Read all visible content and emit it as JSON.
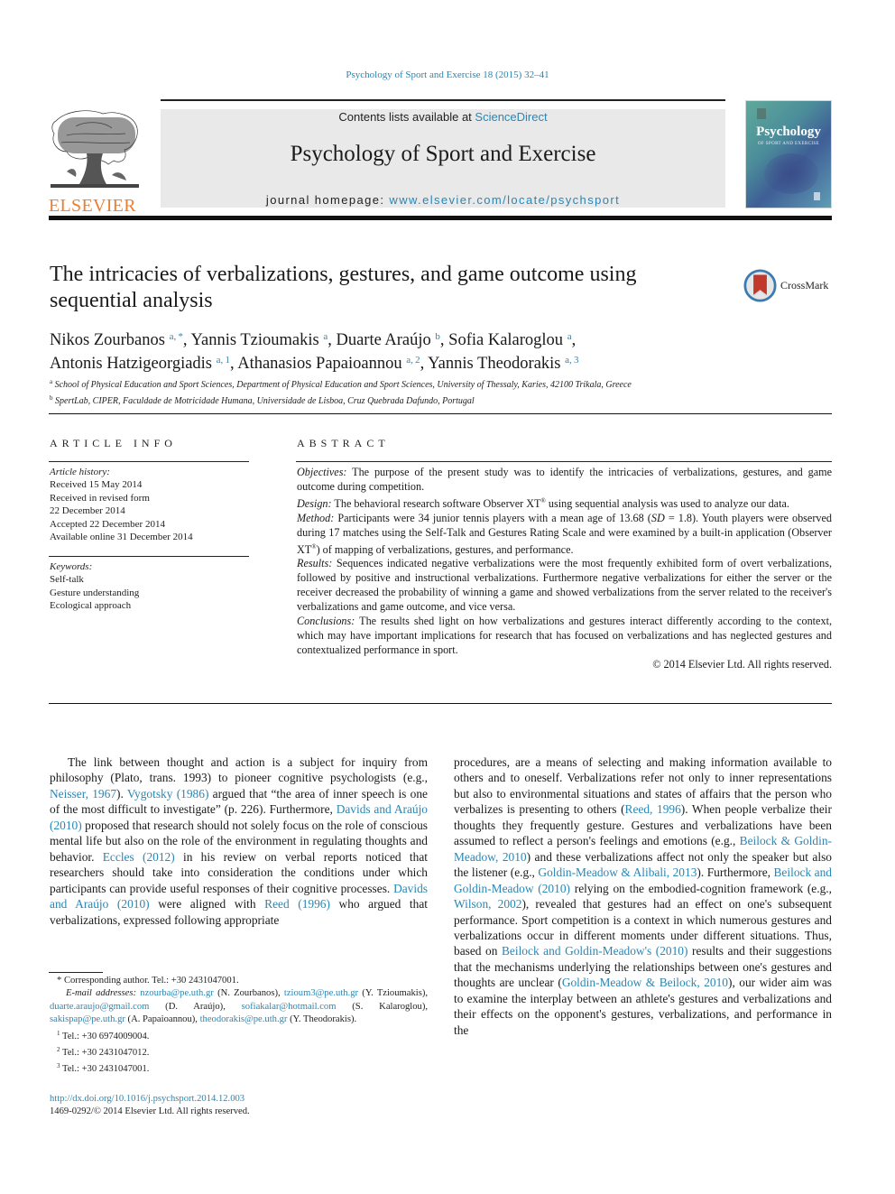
{
  "citation": "Psychology of Sport and Exercise 18 (2015) 32–41",
  "header": {
    "publisher_logo_text": "ELSEVIER",
    "contents_prefix": "Contents lists available at ",
    "contents_link": "ScienceDirect",
    "journal_title": "Psychology of Sport and Exercise",
    "homepage_prefix": "journal homepage: ",
    "homepage_link": "www.elsevier.com/locate/psychsport",
    "cover_title": "Psychology",
    "cover_subtitle": "OF SPORT AND EXERCISE"
  },
  "article": {
    "title": "The intricacies of verbalizations, gestures, and game outcome using sequential analysis",
    "crossmark_label": "CrossMark",
    "authors": [
      {
        "name": "Nikos Zourbanos",
        "sup": "a, *",
        "sep": ", "
      },
      {
        "name": "Yannis Tzioumakis",
        "sup": "a",
        "sep": ", "
      },
      {
        "name": "Duarte Araújo",
        "sup": "b",
        "sep": ", "
      },
      {
        "name": "Sofia Kalaroglou",
        "sup": "a",
        "sep": ","
      },
      {
        "name": "Antonis Hatzigeorgiadis",
        "sup": "a, 1",
        "sep": ", "
      },
      {
        "name": "Athanasios Papaioannou",
        "sup": "a, 2",
        "sep": ", "
      },
      {
        "name": "Yannis Theodorakis",
        "sup": "a, 3",
        "sep": ""
      }
    ],
    "affiliations": [
      {
        "mark": "a",
        "text": "School of Physical Education and Sport Sciences, Department of Physical Education and Sport Sciences, University of Thessaly, Karies, 42100 Trikala, Greece"
      },
      {
        "mark": "b",
        "text": "SpertLab, CIPER, Faculdade de Motricidade Humana, Universidade de Lisboa, Cruz Quebrada Dafundo, Portugal"
      }
    ]
  },
  "article_info": {
    "heading": "ARTICLE INFO",
    "history_label": "Article history:",
    "history": [
      "Received 15 May 2014",
      "Received in revised form",
      "22 December 2014",
      "Accepted 22 December 2014",
      "Available online 31 December 2014"
    ],
    "keywords_label": "Keywords:",
    "keywords": [
      "Self-talk",
      "Gesture understanding",
      "Ecological approach"
    ]
  },
  "abstract": {
    "heading": "ABSTRACT",
    "sections": [
      {
        "label": "Objectives:",
        "text": " The purpose of the present study was to identify the intricacies of verbalizations, gestures, and game outcome during competition."
      },
      {
        "label": "Design:",
        "text_before": " The behavioral research software Observer XT",
        "reg": "®",
        "text_after": " using sequential analysis was used to analyze our data."
      },
      {
        "label": "Method:",
        "text_before": " Participants were 34 junior tennis players with a mean age of 13.68 (",
        "sd": "SD",
        "text_mid": " = 1.8). Youth players were observed during 17 matches using the Self-Talk and Gestures Rating Scale and were examined by a built-in application (Observer XT",
        "reg": "®",
        "text_after": ") of mapping of verbalizations, gestures, and performance."
      },
      {
        "label": "Results:",
        "text": " Sequences indicated negative verbalizations were the most frequently exhibited form of overt verbalizations, followed by positive and instructional verbalizations. Furthermore negative verbalizations for either the server or the receiver decreased the probability of winning a game and showed verbalizations from the server related to the receiver's verbalizations and game outcome, and vice versa."
      },
      {
        "label": "Conclusions:",
        "text": " The results shed light on how verbalizations and gestures interact differently according to the context, which may have important implications for research that has focused on verbalizations and has neglected gestures and contextualized performance in sport."
      }
    ],
    "copyright": "© 2014 Elsevier Ltd. All rights reserved."
  },
  "body": {
    "left": [
      {
        "t": "The link between thought and action is a subject for inquiry from philosophy (Plato, trans. 1993) to pioneer cognitive psychologists (e.g., "
      },
      {
        "l": "Neisser, 1967"
      },
      {
        "t": "). "
      },
      {
        "l": "Vygotsky (1986)"
      },
      {
        "t": " argued that “the area of inner speech is one of the most difficult to investigate” (p. 226). Furthermore, "
      },
      {
        "l": "Davids and Araújo (2010)"
      },
      {
        "t": " proposed that research should not solely focus on the role of conscious mental life but also on the role of the environment in regulating thoughts and behavior. "
      },
      {
        "l": "Eccles (2012)"
      },
      {
        "t": " in his review on verbal reports noticed that researchers should take into consideration the conditions under which participants can provide useful responses of their cognitive processes. "
      },
      {
        "l": "Davids and Araújo (2010)"
      },
      {
        "t": " were aligned with "
      },
      {
        "l": "Reed (1996)"
      },
      {
        "t": " who argued that verbalizations, expressed following appropriate"
      }
    ],
    "right": [
      {
        "t": "procedures, are a means of selecting and making information available to others and to oneself. Verbalizations refer not only to inner representations but also to environmental situations and states of affairs that the person who verbalizes is presenting to others ("
      },
      {
        "l": "Reed, 1996"
      },
      {
        "t": "). When people verbalize their thoughts they frequently gesture. Gestures and verbalizations have been assumed to reflect a person's feelings and emotions (e.g., "
      },
      {
        "l": "Beilock & Goldin-Meadow, 2010"
      },
      {
        "t": ") and these verbalizations affect not only the speaker but also the listener (e.g., "
      },
      {
        "l": "Goldin-Meadow & Alibali, 2013"
      },
      {
        "t": "). Furthermore, "
      },
      {
        "l": "Beilock and Goldin-Meadow (2010)"
      },
      {
        "t": " relying on the embodied-cognition framework (e.g., "
      },
      {
        "l": "Wilson, 2002"
      },
      {
        "t": "), revealed that gestures had an effect on one's subsequent performance. Sport competition is a context in which numerous gestures and verbalizations occur in different moments under different situations. Thus, based on "
      },
      {
        "l": "Beilock and Goldin-Meadow's (2010)"
      },
      {
        "t": " results and their suggestions that the mechanisms underlying the relationships between one's gestures and thoughts are unclear ("
      },
      {
        "l": "Goldin-Meadow & Beilock, 2010"
      },
      {
        "t": "), our wider aim was to examine the interplay between an athlete's gestures and verbalizations and their effects on the opponent's gestures, verbalizations, and performance in the"
      }
    ]
  },
  "footnotes": {
    "corresponding": "* Corresponding author. Tel.: +30 2431047001.",
    "email_label": "E-mail addresses:",
    "emails": [
      {
        "email": "nzourba@pe.uth.gr",
        "who": " (N. Zourbanos), "
      },
      {
        "email": "tzioum3@pe.uth.gr",
        "who": " (Y. Tzioumakis), "
      },
      {
        "email": "duarte.araujo@gmail.com",
        "who": " (D. Araújo), "
      },
      {
        "email": "sofiakalar@hotmail.com",
        "who": " (S. Kalaroglou), "
      },
      {
        "email": "sakispap@pe.uth.gr",
        "who": " (A. Papaioannou), "
      },
      {
        "email": "theodorakis@pe.uth.gr",
        "who": " (Y. Theodorakis)."
      }
    ],
    "tels": [
      {
        "mark": "1",
        "text": " Tel.: +30 6974009004."
      },
      {
        "mark": "2",
        "text": " Tel.: +30 2431047012."
      },
      {
        "mark": "3",
        "text": " Tel.: +30 2431047001."
      }
    ]
  },
  "doi": {
    "link": "http://dx.doi.org/10.1016/j.psychsport.2014.12.003",
    "issn_line": "1469-0292/© 2014 Elsevier Ltd. All rights reserved."
  }
}
